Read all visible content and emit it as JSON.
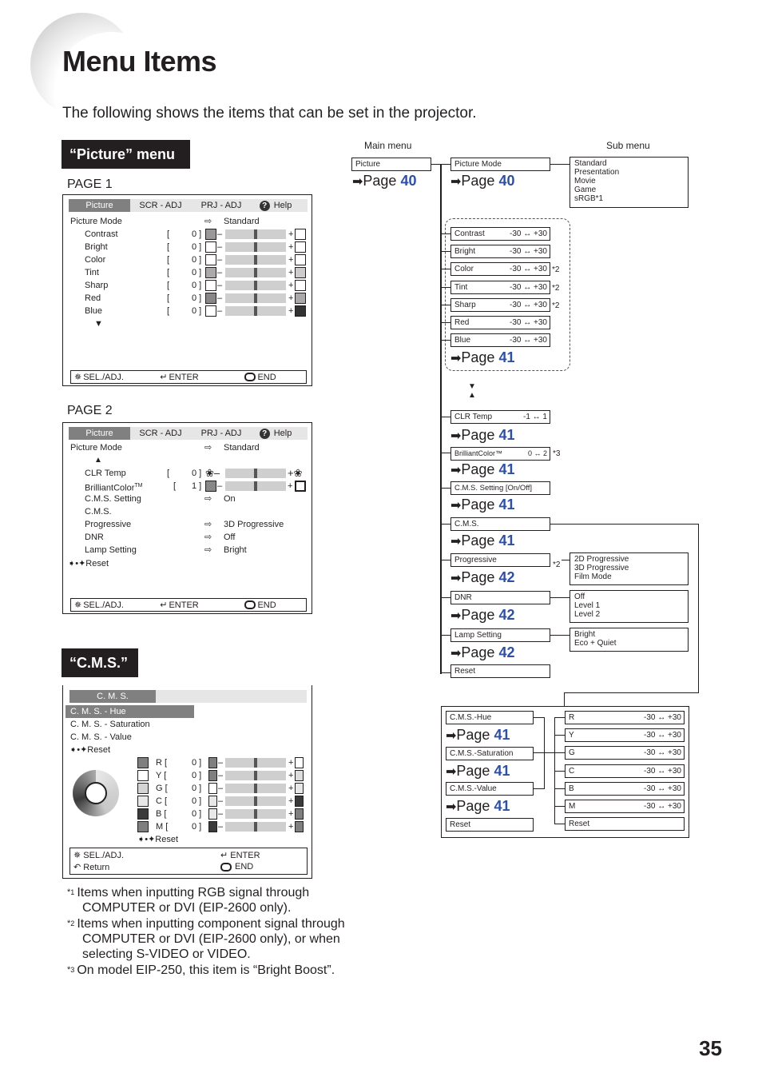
{
  "header": {
    "title": "Menu Items",
    "subtitle": "The following shows the items that can be set in the projector."
  },
  "picture_section": {
    "tag": "“Picture” menu",
    "page1_label": "PAGE 1",
    "page2_label": "PAGE 2"
  },
  "osd_common": {
    "tabs": [
      "Picture",
      "SCR - ADJ",
      "PRJ - ADJ",
      "Help"
    ],
    "footer": {
      "sel_adj": "SEL./ADJ.",
      "enter": "ENTER",
      "end": "END",
      "return": "Return"
    }
  },
  "osd_page1": {
    "picture_mode_label": "Picture Mode",
    "picture_mode_value": "Standard",
    "rows": [
      {
        "label": "Contrast",
        "value": "0"
      },
      {
        "label": "Bright",
        "value": "0"
      },
      {
        "label": "Color",
        "value": "0"
      },
      {
        "label": "Tint",
        "value": "0"
      },
      {
        "label": "Sharp",
        "value": "0"
      },
      {
        "label": "Red",
        "value": "0"
      },
      {
        "label": "Blue",
        "value": "0"
      }
    ],
    "slider_position": 0.5
  },
  "osd_page2": {
    "picture_mode_label": "Picture Mode",
    "picture_mode_value": "Standard",
    "clr_temp": {
      "label": "CLR Temp",
      "value": "0"
    },
    "brilliant": {
      "label": "BrilliantColor",
      "tm": "TM",
      "value": "1"
    },
    "options": [
      {
        "label": "C.M.S. Setting",
        "value": "On"
      },
      {
        "label": "C.M.S.",
        "value": ""
      },
      {
        "label": "Progressive",
        "value": "3D Progressive"
      },
      {
        "label": "DNR",
        "value": "Off"
      },
      {
        "label": "Lamp Setting",
        "value": "Bright"
      }
    ],
    "reset": "Reset"
  },
  "cms_section": {
    "tag": "“C.M.S.”",
    "osd_title": "C. M. S.",
    "items": [
      "C. M. S. - Hue",
      "C. M. S. - Saturation",
      "C. M. S. - Value"
    ],
    "reset": "Reset",
    "colors": [
      {
        "label": "R",
        "value": "0",
        "swatch": "#7f7f7f",
        "minus": "#7f7f7f",
        "plus": "#ffffff"
      },
      {
        "label": "Y",
        "value": "0",
        "swatch": "#ffffff",
        "minus": "#7f7f7f",
        "plus": "#dddddd"
      },
      {
        "label": "G",
        "value": "0",
        "swatch": "#d4d4d4",
        "minus": "#ffffff",
        "plus": "#e8e8e8"
      },
      {
        "label": "C",
        "value": "0",
        "swatch": "#e8e8e8",
        "minus": "#e8e8e8",
        "plus": "#3a3a3a"
      },
      {
        "label": "B",
        "value": "0",
        "swatch": "#3a3a3a",
        "minus": "#e8e8e8",
        "plus": "#7f7f7f"
      },
      {
        "label": "M",
        "value": "0",
        "swatch": "#7f7f7f",
        "minus": "#3a3a3a",
        "plus": "#7f7f7f"
      }
    ],
    "inner_reset": "Reset"
  },
  "diagram": {
    "main_menu_label": "Main menu",
    "sub_menu_label": "Sub menu",
    "page_word": "Page",
    "picture": {
      "label": "Picture",
      "page": "40"
    },
    "picture_mode": {
      "label": "Picture Mode",
      "page": "40",
      "options": [
        "Standard",
        "Presentation",
        "Movie",
        "Game",
        "sRGB*1"
      ]
    },
    "adjust_items": [
      {
        "label": "Contrast",
        "range": "-30 ↔ +30",
        "note": ""
      },
      {
        "label": "Bright",
        "range": "-30 ↔ +30",
        "note": ""
      },
      {
        "label": "Color",
        "range": "-30 ↔ +30",
        "note": "*2"
      },
      {
        "label": "Tint",
        "range": "-30 ↔ +30",
        "note": "*2"
      },
      {
        "label": "Sharp",
        "range": "-30 ↔ +30",
        "note": "*2"
      },
      {
        "label": "Red",
        "range": "-30 ↔ +30",
        "note": ""
      },
      {
        "label": "Blue",
        "range": "-30 ↔ +30",
        "note": ""
      }
    ],
    "adjust_page": "41",
    "clr_temp": {
      "label": "CLR Temp",
      "range": "-1 ↔ 1",
      "page": "41"
    },
    "brilliant": {
      "label": "BrilliantColor™",
      "range": "0 ↔ 2",
      "note": "*3",
      "page": "41"
    },
    "cms_setting": {
      "label": "C.M.S. Setting [On/Off]",
      "page": "41"
    },
    "cms": {
      "label": "C.M.S.",
      "page": "41"
    },
    "progressive": {
      "label": "Progressive",
      "note": "*2",
      "page": "42",
      "options": [
        "2D Progressive",
        "3D Progressive",
        "Film Mode"
      ]
    },
    "dnr": {
      "label": "DNR",
      "page": "42",
      "options": [
        "Off",
        "Level 1",
        "Level 2"
      ]
    },
    "lamp": {
      "label": "Lamp Setting",
      "page": "42",
      "options": [
        "Bright",
        "Eco + Quiet"
      ]
    },
    "reset": {
      "label": "Reset"
    },
    "cms_sub": {
      "items": [
        {
          "label": "C.M.S.-Hue",
          "page": "41"
        },
        {
          "label": "C.M.S.-Saturation",
          "page": "41"
        },
        {
          "label": "C.M.S.-Value",
          "page": "41"
        }
      ],
      "reset": "Reset",
      "colors": [
        {
          "label": "R",
          "range": "-30 ↔ +30"
        },
        {
          "label": "Y",
          "range": "-30 ↔ +30"
        },
        {
          "label": "G",
          "range": "-30 ↔ +30"
        },
        {
          "label": "C",
          "range": "-30 ↔ +30"
        },
        {
          "label": "B",
          "range": "-30 ↔ +30"
        },
        {
          "label": "M",
          "range": "-30 ↔ +30"
        }
      ],
      "color_reset": "Reset"
    }
  },
  "footnotes": [
    {
      "mark": "*",
      "num": "1",
      "lines": [
        "Items when inputting RGB signal through",
        "COMPUTER or DVI (EIP-2600 only)."
      ]
    },
    {
      "mark": "*",
      "num": "2",
      "lines": [
        "Items when inputting component signal through",
        "COMPUTER or DVI (EIP-2600 only), or when",
        "selecting S-VIDEO or VIDEO."
      ]
    },
    {
      "mark": "*",
      "num": "3",
      "lines": [
        "On model EIP-250, this item is “Bright Boost”."
      ]
    }
  ],
  "page_number": "35"
}
